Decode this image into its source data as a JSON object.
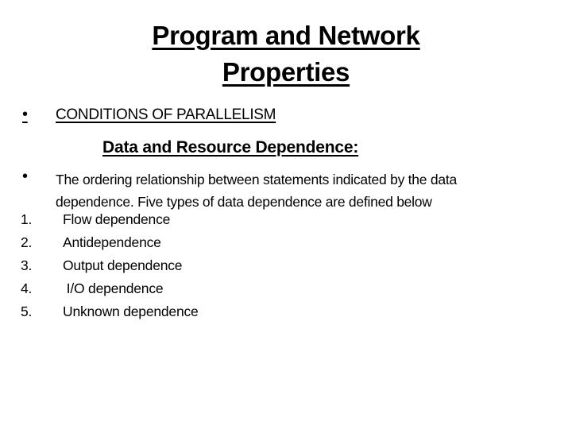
{
  "slide": {
    "title_lines": [
      "Program and Network",
      "Properties"
    ],
    "section_bullet": "•",
    "section_heading": "CONDITIONS OF PARALLELISM",
    "subheading": "Data and Resource Dependence:",
    "paragraph_bullet": "•",
    "paragraph": "The ordering relationship between statements indicated by the data dependence. Five types of data dependence are defined below",
    "paragraph_lines": [
      "The ordering relationship between statements indicated by the data",
      "dependence. Five types of data dependence are defined below"
    ],
    "dependence_types": [
      {
        "number": "1.",
        "label": "Flow dependence"
      },
      {
        "number": "2.",
        "label": "Antidependence"
      },
      {
        "number": "3.",
        "label": "Output dependence"
      },
      {
        "number": "4.",
        "label": " I/O dependence"
      },
      {
        "number": "5.",
        "label": "Unknown dependence"
      }
    ]
  }
}
